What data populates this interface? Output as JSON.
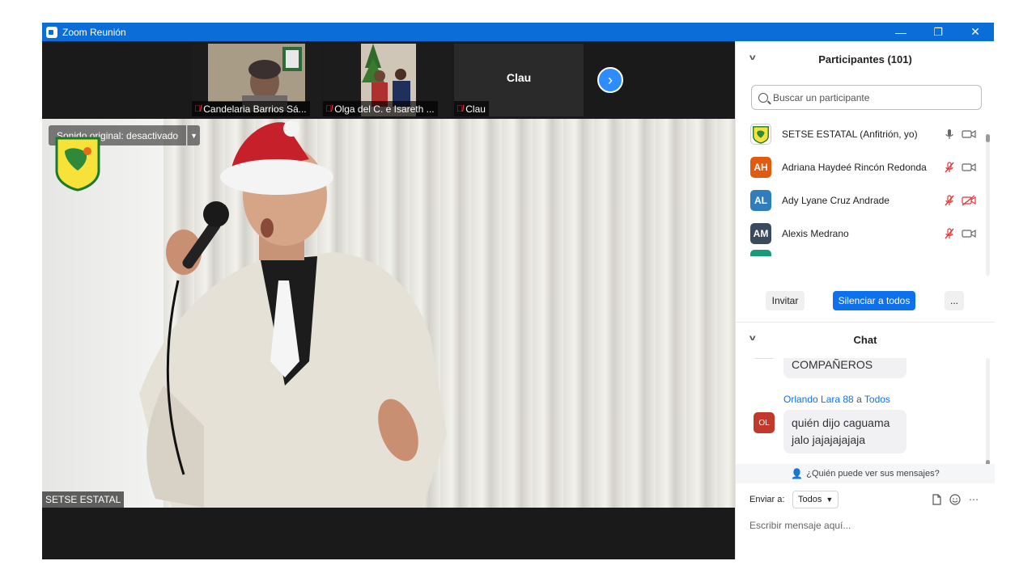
{
  "window": {
    "title": "Zoom Reunión",
    "min_glyph": "—",
    "restore_glyph": "❐",
    "close_glyph": "✕"
  },
  "thumbnails": [
    {
      "name": "Candelaria Barrios Sá...",
      "muted": true
    },
    {
      "name": "Olga del C. e Isareth ...",
      "muted": true
    },
    {
      "name": "Clau",
      "muted": true,
      "display_name": "Clau"
    }
  ],
  "main_video": {
    "sound_label": "Sonido original: desactivado",
    "speaker_name": "SETSE ESTATAL"
  },
  "participants": {
    "title": "Participantes (101)",
    "search_placeholder": "Buscar un participante",
    "list": [
      {
        "name": "SETSE ESTATAL (Anfitrión, yo)",
        "initials": "",
        "color": "#ffffff",
        "mic": "on",
        "cam": "on"
      },
      {
        "name": "Adriana Haydeé Rincón Redonda",
        "initials": "AH",
        "color": "#e25a0f",
        "mic": "off",
        "cam": "on"
      },
      {
        "name": "Ady Lyane Cruz Andrade",
        "initials": "AL",
        "color": "#2f7dbd",
        "mic": "off",
        "cam": "off"
      },
      {
        "name": "Alexis Medrano",
        "initials": "AM",
        "color": "#3a4a5c",
        "mic": "off",
        "cam": "on"
      },
      {
        "name": "",
        "initials": "",
        "color": "#1a9a7a",
        "mic": "off",
        "cam": "on"
      }
    ],
    "invite_label": "Invitar",
    "mute_all_label": "Silenciar a todos",
    "more_label": "..."
  },
  "chat": {
    "title": "Chat",
    "messages": [
      {
        "sender": "",
        "to": "",
        "text": "COMPAÑEROS"
      },
      {
        "sender": "Orlando Lara 88",
        "connector": "a",
        "to": "Todos",
        "initials": "OL",
        "color": "#c0392b",
        "text_line1": "quién dijo caguama",
        "text_line2": "jalo jajajajajaja"
      }
    ],
    "who_sees": "¿Quién puede ver sus mensajes?",
    "send_to_label": "Enviar a:",
    "send_to_value": "Todos",
    "input_placeholder": "Escribir mensaje aquí...",
    "accent": "#0e71eb"
  }
}
